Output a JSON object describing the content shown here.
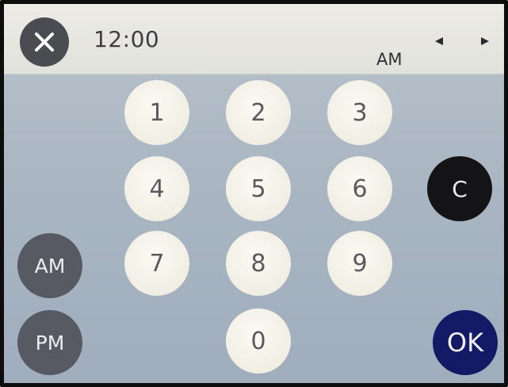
{
  "header": {
    "close_icon": "close-x-icon",
    "time": "12:00",
    "period": "AM",
    "prev_icon": "triangle-left-icon",
    "next_icon": "triangle-right-icon"
  },
  "keypad": {
    "digits": [
      "1",
      "2",
      "3",
      "4",
      "5",
      "6",
      "7",
      "8",
      "9",
      "0"
    ]
  },
  "buttons": {
    "am_label": "AM",
    "pm_label": "PM",
    "clear_label": "C",
    "ok_label": "OK"
  },
  "colors": {
    "clear_button": "#141416",
    "ok_button": "#141b66",
    "ampm_buttons": "#585a63",
    "key_face": "#f1eee4"
  }
}
